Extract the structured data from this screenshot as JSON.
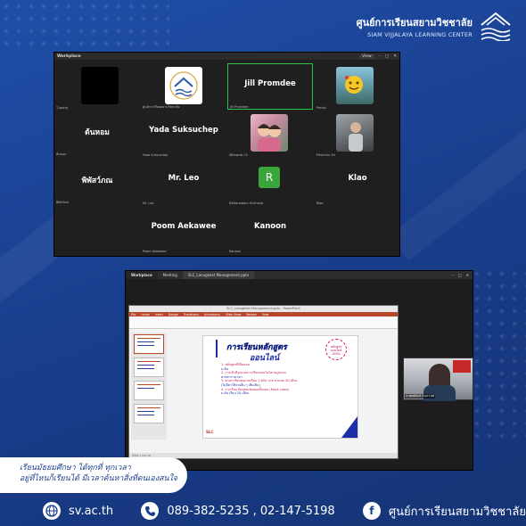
{
  "brand": {
    "thai": "ศูนย์การเรียนสยามวิชชาลัย",
    "english": "SIAM VIJJALAYA LEARNING CENTER"
  },
  "meeting": {
    "title": "Workplace",
    "view_label": "View",
    "tiles": [
      {
        "display": "",
        "footer": "T-ipong"
      },
      {
        "display": "",
        "footer": "ศูนย์การเรียนสยามวิชชาลัย"
      },
      {
        "display": "Jill Promdee",
        "footer": "Jill Promdee"
      },
      {
        "display": "",
        "footer": "Pan4p"
      },
      {
        "display": "ต้นหอม",
        "footer": "ต้นหอม"
      },
      {
        "display": "Yada Suksuchep",
        "footer": "Yada Suksuchep"
      },
      {
        "display": "",
        "footer": "Wilawrat Ch"
      },
      {
        "display": "",
        "footer": "Pitsinthu Sri"
      },
      {
        "display": "พิพัสว์ภณ",
        "footer": "พิพัสว์ภณ"
      },
      {
        "display": "Mr. Leo",
        "footer": "Mr. Leo"
      },
      {
        "display": "R",
        "footer": "Rattanaporn Srichana"
      },
      {
        "display": "Klao",
        "footer": "Klao"
      },
      {
        "display": "Poom Aekawee",
        "footer": "Poom Aekawee"
      },
      {
        "display": "Kanoon",
        "footer": "Kanoon"
      }
    ]
  },
  "share": {
    "tabs": [
      "Workplace",
      "Meeting",
      "SLC_Lanugkeet Management.pptx"
    ],
    "ppt_title": "SLC_Lanugkeet Management.pptx - PowerPoint",
    "menu": [
      "File",
      "Home",
      "Insert",
      "Design",
      "Transitions",
      "Animations",
      "Slide Show",
      "Review",
      "View"
    ],
    "slide": {
      "title1": "การเรียนหลักสูตร",
      "title2": "ออนไลน์",
      "badge": "หลักสูตร ออนไลน์ 100%",
      "items": [
        "1. หลักสูตรที่เปิดสอน",
        "   ม.ต้น",
        "2. การเข้ามีรูปแบบการเรียนออนไลน์ตามรูปแบบ",
        "   ตามตารางเวลา",
        "3. ค่าเล่าเรียนต่อภาคเรียน 2,600 บาท ส่วนลด 30 เดือน",
        "   (ไม่มีค่าใช้จ่ายอื่น ๆ เพิ่มเติม)",
        "4. การเรียน ปิดเทอมจัดสอบทั้งหมด (Mock class)",
        "   ม.ต้น เรียน 20 เดือน"
      ],
      "logo": "SLC"
    },
    "status": "สไลด์ 1 จาก 10",
    "video_label": "นายสุทธินันท์ ประภาวงศ์"
  },
  "slogan": {
    "line1": "เรียนมัธยมศึกษา ได้ทุกที่ ทุกเวลา",
    "line2": "อยู่ที่ไหนก็เรียนได้ มีเวลาค้นหาสิ่งที่ตนเองสนใจ"
  },
  "footer": {
    "website": "sv.ac.th",
    "phones": "089-382-5235 ,  02-147-5198",
    "facebook": "ศูนย์การเรียนสยามวิชชาลัย"
  }
}
